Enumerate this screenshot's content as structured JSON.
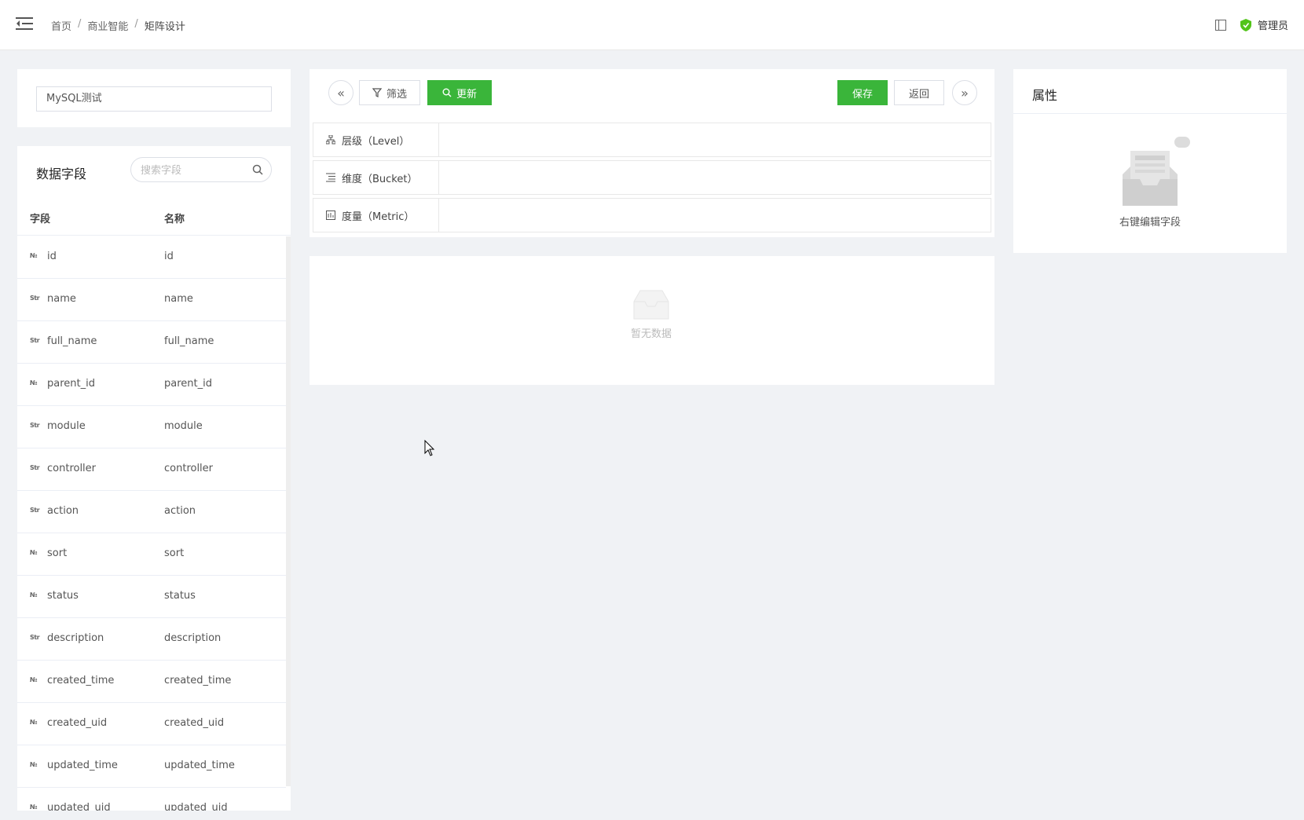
{
  "header": {
    "breadcrumb": [
      "首页",
      "商业智能",
      "矩阵设计"
    ],
    "separator": "/",
    "user": "管理员"
  },
  "datasource": {
    "value": "MySQL测试"
  },
  "fields_panel": {
    "title": "数据字段",
    "search_placeholder": "搜索字段",
    "col_field": "字段",
    "col_name": "名称",
    "rows": [
      {
        "type": "№",
        "field": "id",
        "name": "id"
      },
      {
        "type": "Str",
        "field": "name",
        "name": "name"
      },
      {
        "type": "Str",
        "field": "full_name",
        "name": "full_name"
      },
      {
        "type": "№",
        "field": "parent_id",
        "name": "parent_id"
      },
      {
        "type": "Str",
        "field": "module",
        "name": "module"
      },
      {
        "type": "Str",
        "field": "controller",
        "name": "controller"
      },
      {
        "type": "Str",
        "field": "action",
        "name": "action"
      },
      {
        "type": "№",
        "field": "sort",
        "name": "sort"
      },
      {
        "type": "№",
        "field": "status",
        "name": "status"
      },
      {
        "type": "Str",
        "field": "description",
        "name": "description"
      },
      {
        "type": "№",
        "field": "created_time",
        "name": "created_time"
      },
      {
        "type": "№",
        "field": "created_uid",
        "name": "created_uid"
      },
      {
        "type": "№",
        "field": "updated_time",
        "name": "updated_time"
      },
      {
        "type": "№",
        "field": "updated_uid",
        "name": "updated_uid"
      }
    ]
  },
  "toolbar": {
    "filter_label": "筛选",
    "refresh_label": "更新",
    "save_label": "保存",
    "back_label": "返回",
    "collapse_left": "«",
    "expand_right": "»"
  },
  "zones": {
    "level": "层级（Level）",
    "bucket": "维度（Bucket）",
    "metric": "度量（Metric）"
  },
  "result": {
    "empty_text": "暂无数据"
  },
  "properties": {
    "title": "属性",
    "empty_text": "右键编辑字段"
  },
  "colors": {
    "accent": "#3ab53a",
    "shield": "#52c41a"
  }
}
